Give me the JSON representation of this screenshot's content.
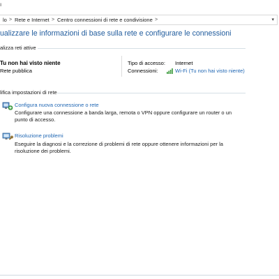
{
  "address": {
    "crumb_root": "lo",
    "crumb_network": "Rete e Internet",
    "crumb_center": "Centro connessioni di rete e condivisione",
    "separator": ">"
  },
  "page": {
    "title": "ualizzare le informazioni di base sulla rete e configurare le connessioni"
  },
  "active_networks": {
    "header": "alizza reti attive",
    "network_name": "Tu non hai visto niente",
    "network_type": "Rete pubblica",
    "access_type_label": "Tipo di accesso:",
    "access_type_value": "Internet",
    "connections_label": "Connessioni:",
    "connection_link": "Wi-Fi (Tu non hai visto niente)"
  },
  "change_settings": {
    "header": "lifica impostazioni di rete",
    "tasks": [
      {
        "icon": "network-setup-icon",
        "title": "Configura nuova connessione o rete",
        "desc_line1": "Configurare una connessione a banda larga, remota o VPN oppure configurare un router o un",
        "desc_line2": "punto di accesso."
      },
      {
        "icon": "troubleshoot-icon",
        "title": "Risoluzione problemi",
        "desc_line1": "Eseguire la diagnosi e la correzione di problemi di rete oppure ottenere informazioni per la",
        "desc_line2": "risoluzione dei problemi."
      }
    ]
  },
  "colors": {
    "title_blue": "#1e5a9c",
    "link_blue": "#1f66b3",
    "rule": "#d5dfe5",
    "wifi_green": "#3a9a3a"
  }
}
